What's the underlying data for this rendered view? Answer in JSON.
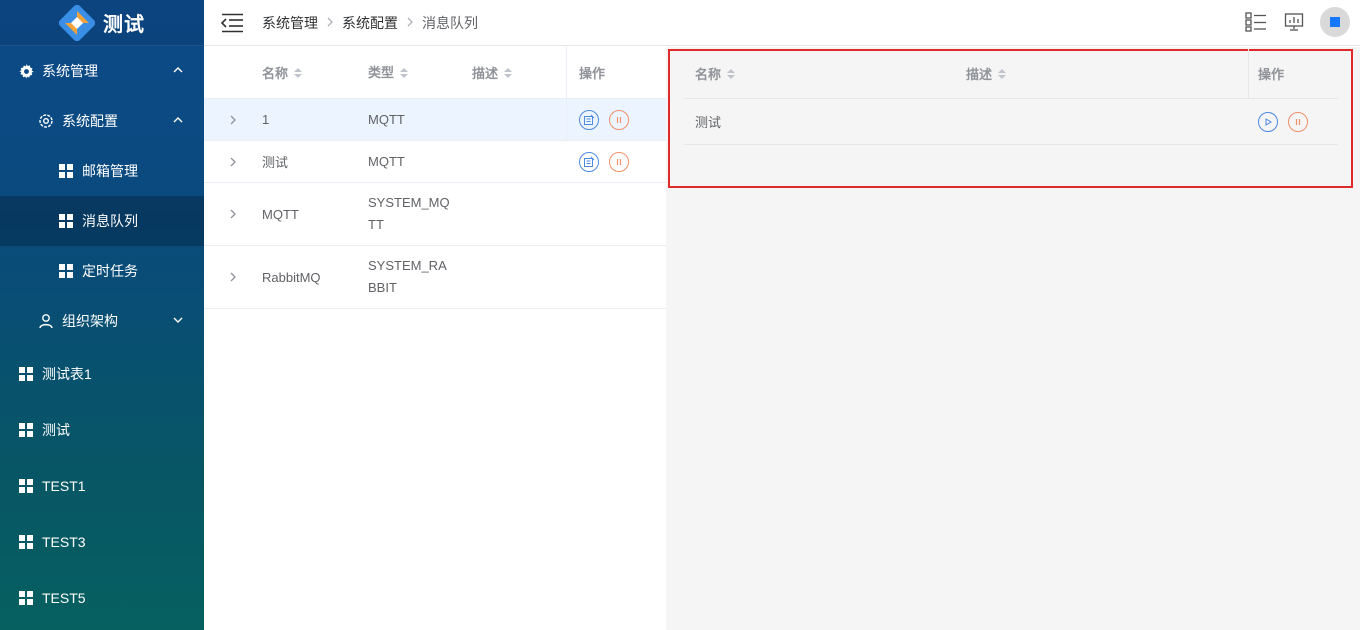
{
  "app": {
    "title": "测试"
  },
  "sidebar": {
    "items": [
      {
        "label": "系统管理",
        "icon": "gear-icon",
        "expanded": true
      },
      {
        "label": "系统配置",
        "icon": "settings-icon",
        "expanded": true
      },
      {
        "label": "邮箱管理",
        "icon": "grid-icon"
      },
      {
        "label": "消息队列",
        "icon": "grid-icon",
        "active": true
      },
      {
        "label": "定时任务",
        "icon": "grid-icon"
      },
      {
        "label": "组织架构",
        "icon": "user-icon",
        "expanded": false
      },
      {
        "label": "测试表1",
        "icon": "grid-icon"
      },
      {
        "label": "测试",
        "icon": "grid-icon"
      },
      {
        "label": "TEST1",
        "icon": "grid-icon"
      },
      {
        "label": "TEST3",
        "icon": "grid-icon"
      },
      {
        "label": "TEST5",
        "icon": "grid-icon"
      }
    ]
  },
  "header": {
    "breadcrumb": [
      "系统管理",
      "系统配置",
      "消息队列"
    ]
  },
  "left_table": {
    "columns": [
      "名称",
      "类型",
      "描述",
      "操作"
    ],
    "rows": [
      {
        "name": "1",
        "type": "MQTT",
        "desc": ""
      },
      {
        "name": "测试",
        "type": "MQTT",
        "desc": ""
      },
      {
        "name": "MQTT",
        "type": "SYSTEM_MQTT",
        "desc": ""
      },
      {
        "name": "RabbitMQ",
        "type": "SYSTEM_RABBIT",
        "desc": ""
      }
    ]
  },
  "right_table": {
    "columns": [
      "名称",
      "描述",
      "操作"
    ],
    "rows": [
      {
        "name": "测试",
        "desc": ""
      }
    ]
  },
  "colors": {
    "accent": "#1677ff",
    "highlight_border": "#e02a2a",
    "action_blue": "#4e8ae0",
    "action_orange": "#f0906b"
  }
}
